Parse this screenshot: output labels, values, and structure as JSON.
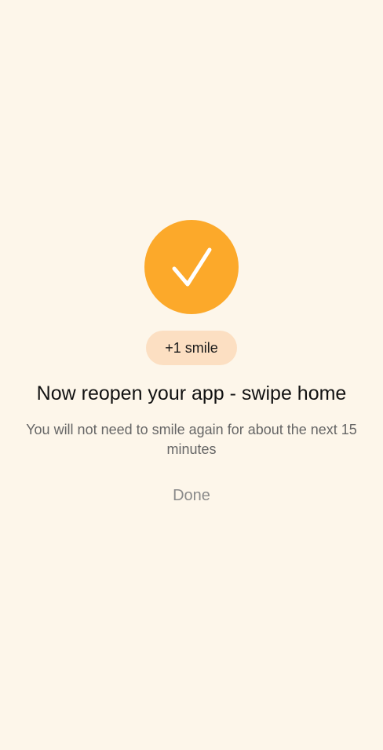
{
  "success": {
    "icon": "checkmark-icon",
    "accent_color": "#FCA92A"
  },
  "badge": {
    "label": "+1 smile",
    "color": "#FCDFC2"
  },
  "title": "Now reopen your app - swipe home",
  "subtitle": "You will not need to smile again for about the next 15 minutes",
  "done_label": "Done",
  "colors": {
    "background": "#FDF6EA",
    "title_text": "#111111",
    "subtitle_text": "#666666",
    "done_text": "#8A8A8A"
  }
}
